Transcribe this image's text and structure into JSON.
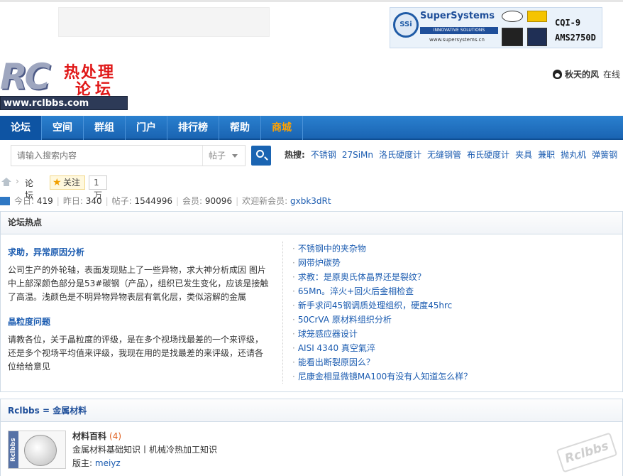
{
  "banner": {
    "company": "SuperSystems",
    "tagline": "INNOVATIVE SOLUTIONS WORLDWIDE",
    "url": "www.supersystems.cn",
    "cert1": "CQI-9",
    "cert2": "AMS2750D"
  },
  "logo": {
    "letters": "RC",
    "cn_line1": "热处理",
    "cn_line2": "论坛",
    "site": "www.rclbbs.com"
  },
  "user": {
    "name": "秋天的风",
    "status": "在线"
  },
  "nav": {
    "items": [
      {
        "label": "论坛",
        "active": true
      },
      {
        "label": "空间"
      },
      {
        "label": "群组"
      },
      {
        "label": "门户"
      },
      {
        "label": "排行榜"
      },
      {
        "label": "帮助"
      },
      {
        "label": "商城",
        "color": "#ffa200"
      }
    ]
  },
  "search": {
    "placeholder": "请输入搜索内容",
    "scope": "帖子",
    "hot_label": "热搜:",
    "hot_keywords": [
      "不锈钢",
      "27SiMn",
      "洛氏硬度计",
      "无缝钢管",
      "布氏硬度计",
      "夹具",
      "兼职",
      "抛丸机",
      "弹簧钢"
    ]
  },
  "breadcrumb": {
    "current": "论坛",
    "follow_label": "关注",
    "follow_count": "1万"
  },
  "stats": {
    "today_label": "今日:",
    "today": "419",
    "yesterday_label": "昨日:",
    "yesterday": "340",
    "posts_label": "帖子:",
    "posts": "1544996",
    "members_label": "会员:",
    "members": "90096",
    "newest_label": "欢迎新会员:",
    "newest": "gxbk3dRt"
  },
  "hot": {
    "title": "论坛热点",
    "featured": [
      {
        "title": "求助，异常原因分析",
        "desc": "公司生产的外轮轴，表面发现贴上了一些异物，求大神分析成因 图片中上部深颜色部分是53#碳钢（产品），组织已发生变化，应该是接触了高温。浅颜色是不明异物异物表层有氧化层，类似溶解的金属"
      },
      {
        "title": "晶粒度问题",
        "desc": "请教各位，关于晶粒度的评级，是在多个视场找最差的一个来评级，还是多个视场平均值来评级，我现在用的是找最差的来评级，还请各位给给意见"
      }
    ],
    "links": [
      "不锈钢中的夹杂物",
      "网带炉碳势",
      "求教：是原奥氏体晶界还是裂纹？",
      "65Mn。淬火+回火后金相检查",
      "新手求问45钢调质处理组织，硬度45hrc",
      "50CrVA 原材料组织分析",
      "球笼感应器设计",
      "AISI 4340 真空氣淬",
      "能看出断裂原因么？",
      "尼康金相显微镜MA100有没有人知道怎么样？"
    ]
  },
  "category": {
    "title": "Rclbbs = 金属材料",
    "icon_side_text": "Rclbbs",
    "forum": {
      "name": "材料百科",
      "count": "(4)",
      "desc": "金属材料基础知识丨机械冷热加工知识",
      "mod_label": "版主:",
      "mod": "meiyz"
    },
    "watermark": "Rclbbs"
  }
}
